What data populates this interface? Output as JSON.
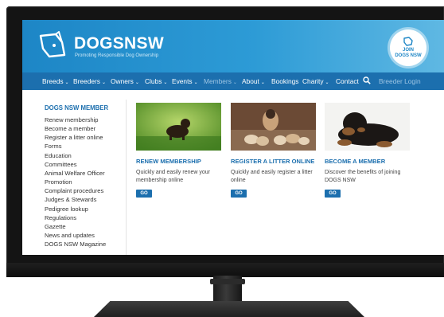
{
  "brand": {
    "name_part1": "DOGS",
    "name_part2": "NSW",
    "tagline": "Promoting Responsible Dog Ownership",
    "join_badge_line1": "JOIN",
    "join_badge_line2": "DOGS NSW",
    "colors": {
      "primary": "#1c6fae",
      "banner": "#2d9bd6",
      "muted_nav": "#9dc5e4"
    }
  },
  "nav": {
    "items": [
      {
        "label": "Breeds",
        "has_dropdown": true
      },
      {
        "label": "Breeders",
        "has_dropdown": true
      },
      {
        "label": "Owners",
        "has_dropdown": true
      },
      {
        "label": "Clubs",
        "has_dropdown": true
      },
      {
        "label": "Events",
        "has_dropdown": true
      },
      {
        "label": "Members",
        "has_dropdown": true,
        "active": true
      },
      {
        "label": "About",
        "has_dropdown": true
      },
      {
        "label": "Bookings",
        "has_dropdown": false
      },
      {
        "label": "Charity",
        "has_dropdown": true
      },
      {
        "label": "Contact",
        "has_dropdown": false
      }
    ],
    "search_icon": "search-icon",
    "login_label": "Breeder Login"
  },
  "sidebar": {
    "title": "DOGS NSW MEMBER",
    "items": [
      "Renew membership",
      "Become a member",
      "Register a litter online",
      "Forms",
      "Education",
      "Committees",
      "Animal Welfare Officer",
      "Promotion",
      "Complaint procedures",
      "Judges & Stewards",
      "Pedigree lookup",
      "Regulations",
      "Gazette",
      "News and updates",
      "DOGS NSW Magazine"
    ]
  },
  "cards": [
    {
      "title": "RENEW MEMBERSHIP",
      "description": "Quickly and easily renew your membership online",
      "button": "GO"
    },
    {
      "title": "REGISTER A LITTER ONLINE",
      "description": "Quickly and easily register a litter online",
      "button": "GO"
    },
    {
      "title": "BECOME A MEMBER",
      "description": "Discover the benefits of joining DOGS NSW",
      "button": "GO"
    }
  ]
}
